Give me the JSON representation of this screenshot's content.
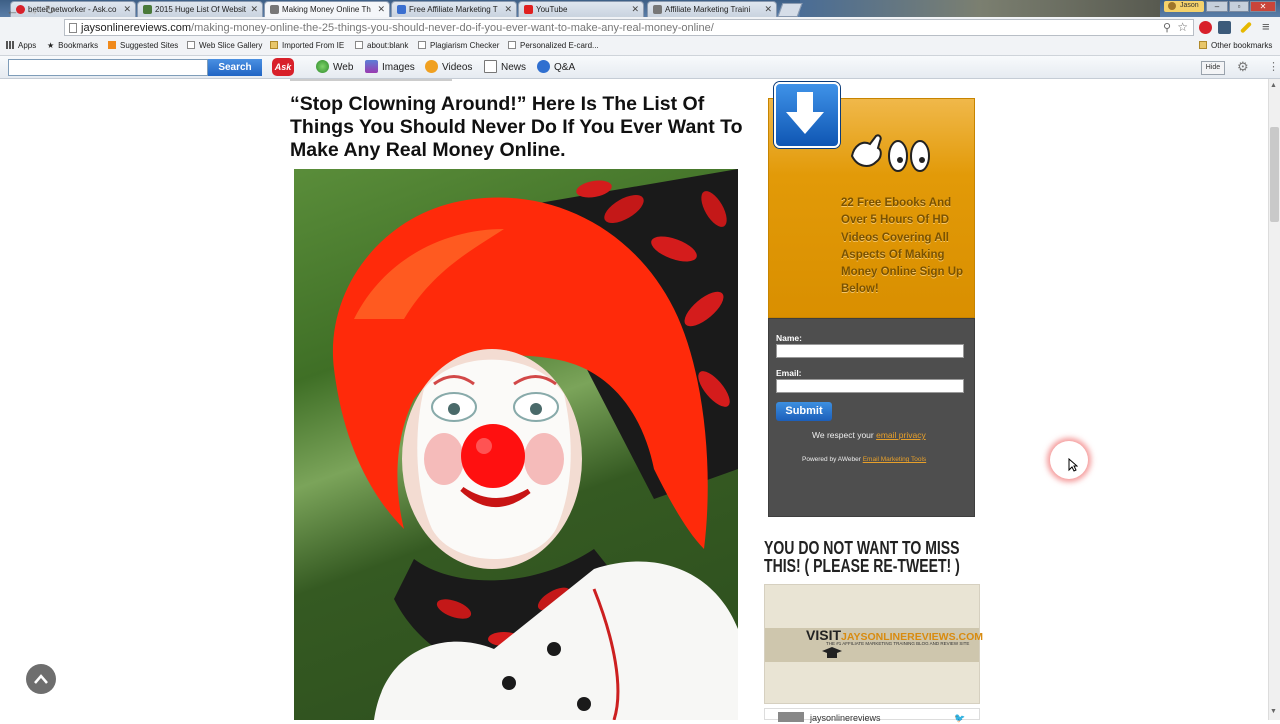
{
  "browser": {
    "tabs": [
      {
        "label": "better networker - Ask.co",
        "icon_color": "#d8202a",
        "active": false
      },
      {
        "label": "2015 Huge List Of Websit",
        "icon_color": "#4a7a3a",
        "active": false
      },
      {
        "label": "Making Money Online Th",
        "icon_color": "#777777",
        "active": true
      },
      {
        "label": "Free Affiliate Marketing T",
        "icon_color": "#3a6fd0",
        "active": false
      },
      {
        "label": "YouTube",
        "icon_color": "#e02020",
        "active": false
      },
      {
        "label": "Affiliate Marketing Traini",
        "icon_color": "#777777",
        "active": false
      }
    ],
    "user_name": "Jason",
    "url_domain": "jaysonlinereviews.com",
    "url_path": "/making-money-online-the-25-things-you-should-never-do-if-you-ever-want-to-make-any-real-money-online/"
  },
  "bookmarks": {
    "items": [
      "Apps",
      "Bookmarks",
      "Suggested Sites",
      "Web Slice Gallery",
      "Imported From IE",
      "about:blank",
      "Plagiarism Checker",
      "Personalized E-card..."
    ],
    "other": "Other bookmarks"
  },
  "ask_toolbar": {
    "search_label": "Search",
    "logo": "Ask",
    "items": [
      "Web",
      "Images",
      "Videos",
      "News",
      "Q&A"
    ],
    "hide_label": "Hide"
  },
  "article": {
    "title": "“Stop Clowning Around!” Here Is The List Of Things You Should Never Do If You Ever Want To Make Any Real Money Online."
  },
  "optin": {
    "text": "22 Free Ebooks And Over 5 Hours Of HD Videos Covering All Aspects Of Making Money Online Sign Up Below!",
    "name_label": "Name:",
    "email_label": "Email:",
    "submit": "Submit",
    "privacy_prefix": "We respect your ",
    "privacy_link": "email privacy",
    "powered_prefix": "Powered by AWeber ",
    "powered_link": "Email Marketing Tools"
  },
  "sidebar": {
    "tweet_heading": "YOU DO NOT WANT TO MISS THIS! ( PLEASE RE-TWEET! )",
    "visit_word": "VISIT",
    "visit_domain": "JAYSONLINEREVIEWS.COM",
    "visit_sub": "THE #1 AFFILIATE MARKETING TRAINING BLOG AND REVIEW SITE",
    "twitter_name": "jaysonlinereviews"
  },
  "colors": {
    "optin_orange": "#e29a08",
    "optin_dark": "#4e4e4e",
    "accent_blue": "#1f64c4",
    "link_orange": "#e8a02a"
  }
}
